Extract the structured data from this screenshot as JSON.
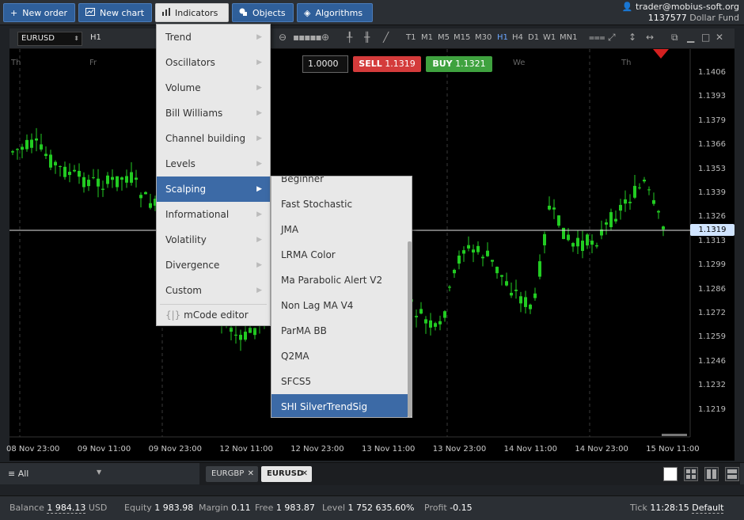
{
  "toolbar": {
    "new_order": "New order",
    "new_chart": "New chart",
    "indicators": "Indicators",
    "objects": "Objects",
    "algorithms": "Algorithms"
  },
  "account": {
    "user": "trader@mobius-soft.org",
    "number": "1137577",
    "fund": "Dollar Fund"
  },
  "chart_toolbar": {
    "symbol": "EURUSD",
    "timeframe": "H1",
    "timeframes": [
      "T1",
      "M1",
      "M5",
      "M15",
      "M30",
      "H1",
      "H4",
      "D1",
      "W1",
      "MN1"
    ],
    "selected_timeframe": "H1"
  },
  "trade": {
    "lot": "1.0000",
    "sell_label": "SELL",
    "sell_price": "1.1319",
    "buy_label": "BUY",
    "buy_price": "1.1321"
  },
  "chart": {
    "current_price": "1.1319",
    "y_ticks": [
      "1.1406",
      "1.1393",
      "1.1379",
      "1.1366",
      "1.1353",
      "1.1339",
      "1.1326",
      "1.1313",
      "1.1299",
      "1.1286",
      "1.1272",
      "1.1259",
      "1.1246",
      "1.1232",
      "1.1219"
    ],
    "x_ticks": [
      "08 Nov 23:00",
      "09 Nov 11:00",
      "09 Nov 23:00",
      "12 Nov 11:00",
      "12 Nov 23:00",
      "13 Nov 11:00",
      "13 Nov 23:00",
      "14 Nov 11:00",
      "14 Nov 23:00",
      "15 Nov 11:00"
    ],
    "day_labels": [
      "Th",
      "Fr",
      "We",
      "Th"
    ],
    "colors": {
      "bull": "#22cc22",
      "bear": "#22cc22",
      "bg": "#000000",
      "grid": "#444444"
    }
  },
  "indicators_menu": {
    "items": [
      {
        "label": "Trend"
      },
      {
        "label": "Oscillators"
      },
      {
        "label": "Volume"
      },
      {
        "label": "Bill Williams"
      },
      {
        "label": "Channel building"
      },
      {
        "label": "Levels"
      },
      {
        "label": "Scalping"
      },
      {
        "label": "Informational"
      },
      {
        "label": "Volatility"
      },
      {
        "label": "Divergence"
      },
      {
        "label": "Custom"
      }
    ],
    "selected": "Scalping",
    "editor": "mCode editor"
  },
  "scalping_submenu": {
    "items": [
      "Beginner",
      "Fast Stochastic",
      "JMA",
      "LRMA Color",
      "Ma Parabolic Alert V2",
      "Non Lag MA V4",
      "ParMA BB",
      "Q2MA",
      "SFCS5",
      "SHI SilverTrendSig"
    ],
    "selected": "SHI SilverTrendSig"
  },
  "tabs": {
    "filter": "All",
    "items": [
      "EURGBP",
      "EURUSD"
    ],
    "active": "EURUSD"
  },
  "status": {
    "balance_label": "Balance",
    "balance": "1 984.13",
    "currency": "USD",
    "equity_label": "Equity",
    "equity": "1 983.98",
    "margin_label": "Margin",
    "margin": "0.11",
    "free_label": "Free",
    "free": "1 983.87",
    "level_label": "Level",
    "level": "1 752 635.60%",
    "profit_label": "Profit",
    "profit": "-0.15",
    "tick_label": "Tick",
    "tick": "11:28:15",
    "tick_mode": "Default"
  }
}
